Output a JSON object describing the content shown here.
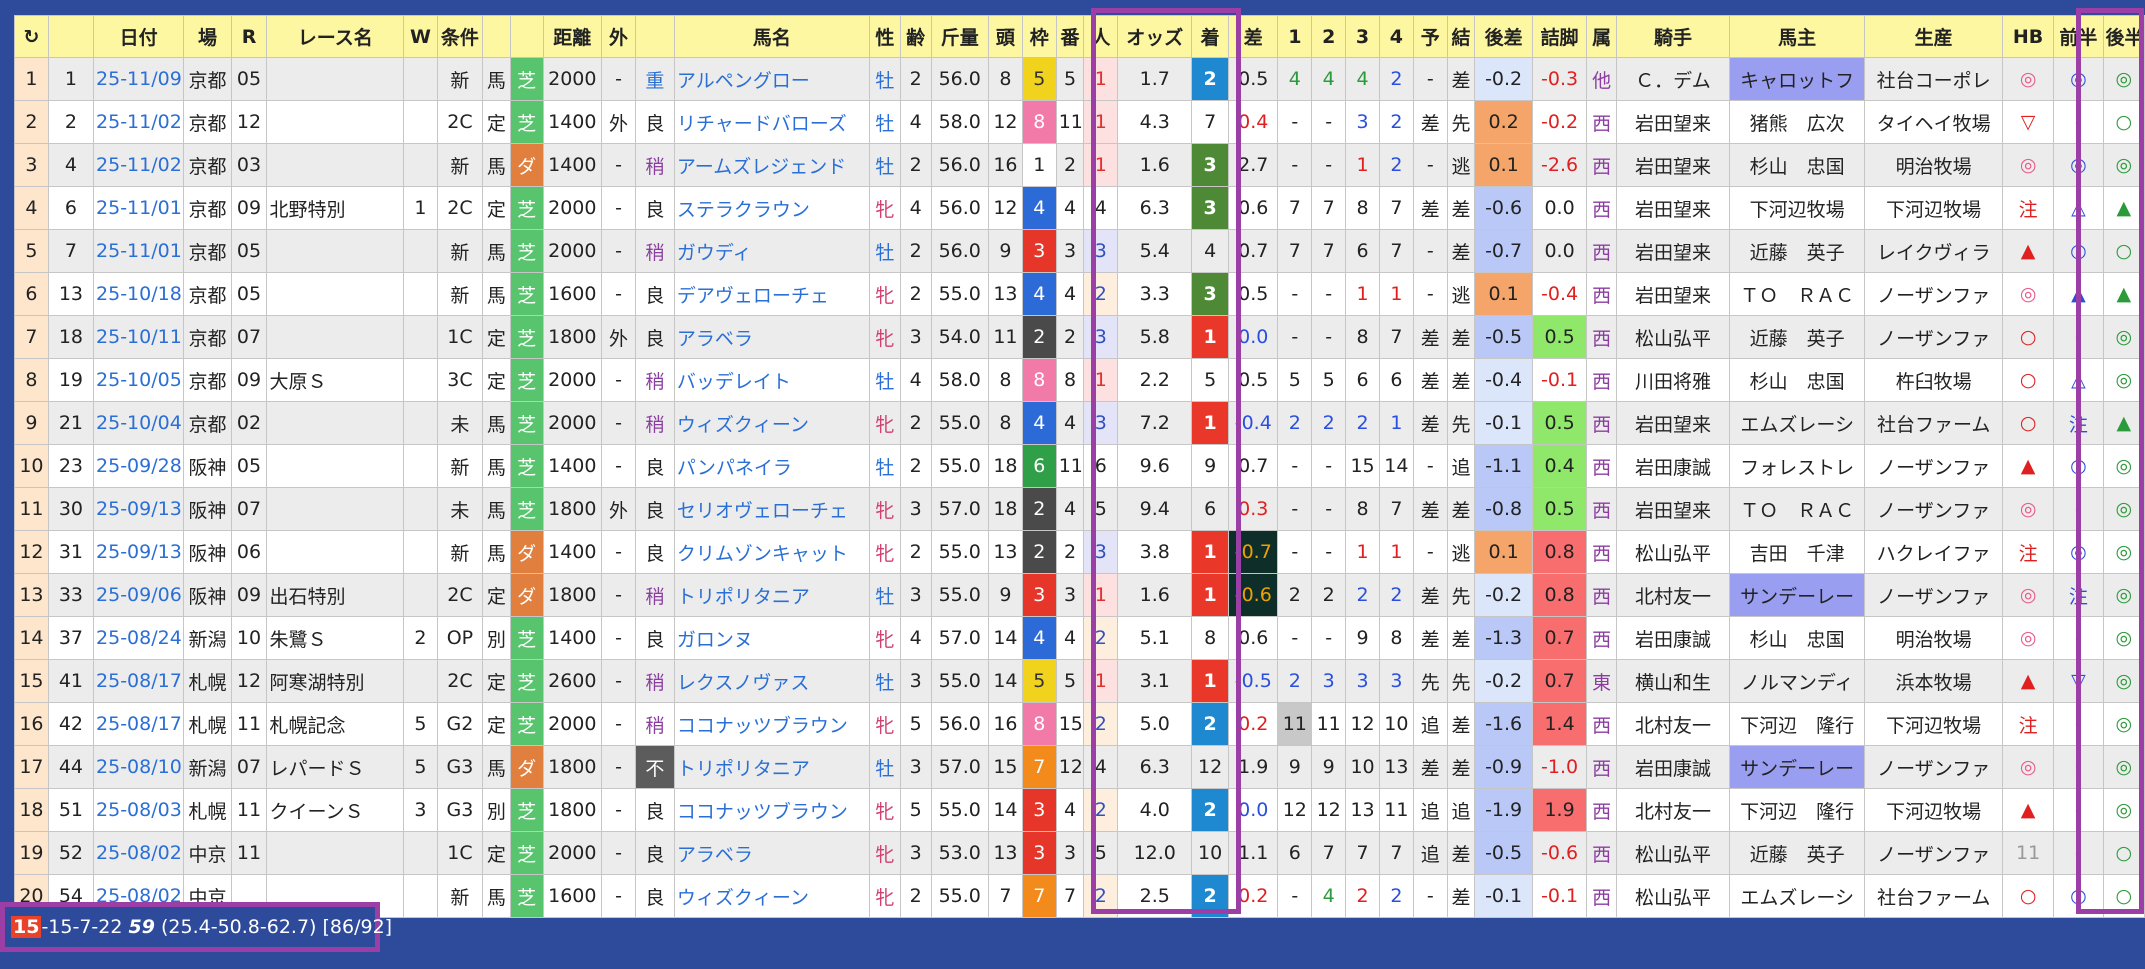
{
  "headers": [
    "↻",
    "",
    "日付",
    "場",
    "R",
    "レース名",
    "W",
    "条件",
    "",
    "",
    "距離",
    "外",
    "",
    "馬名",
    "性",
    "齢",
    "斤量",
    "頭",
    "枠",
    "番",
    "人",
    "オッズ",
    "着",
    "差",
    "1",
    "2",
    "3",
    "4",
    "予",
    "結",
    "後差",
    "詰脚",
    "属",
    "騎手",
    "馬主",
    "生産",
    "HB",
    "前半",
    "後半"
  ],
  "rows": [
    [
      "1",
      "1",
      "25-11/09",
      "京都",
      "05",
      "",
      "",
      "新",
      "馬",
      "芝",
      "2000",
      "-",
      "重",
      "アルペングロー",
      "牡",
      "2",
      "56.0",
      "8",
      "5",
      "5",
      "1",
      "1.7",
      "2",
      "0.5",
      "4",
      "4",
      "4",
      "2",
      "-",
      "差",
      "-0.2",
      "-0.3",
      "他",
      "Ｃ．デム",
      "キャロットフ",
      "社台コーポレ",
      "◎",
      "◎",
      "◎"
    ],
    [
      "2",
      "2",
      "25-11/02",
      "京都",
      "12",
      "",
      "",
      "2C",
      "定",
      "芝",
      "1400",
      "外",
      "良",
      "リチャードバローズ",
      "牡",
      "4",
      "58.0",
      "12",
      "8",
      "11",
      "1",
      "4.3",
      "7",
      "0.4",
      "-",
      "-",
      "3",
      "2",
      "差",
      "先",
      "0.2",
      "-0.2",
      "西",
      "岩田望来",
      "猪熊　広次",
      "タイヘイ牧場",
      "▽",
      "-",
      "○"
    ],
    [
      "3",
      "4",
      "25-11/02",
      "京都",
      "03",
      "",
      "",
      "新",
      "馬",
      "ダ",
      "1400",
      "-",
      "稍",
      "アームズレジェンド",
      "牡",
      "2",
      "56.0",
      "16",
      "1",
      "2",
      "1",
      "1.6",
      "3",
      "2.7",
      "-",
      "-",
      "1",
      "2",
      "-",
      "逃",
      "0.1",
      "-2.6",
      "西",
      "岩田望来",
      "杉山　忠国",
      "明治牧場",
      "◎",
      "◎",
      "◎"
    ],
    [
      "4",
      "6",
      "25-11/01",
      "京都",
      "09",
      "北野特別",
      "1",
      "2C",
      "定",
      "芝",
      "2000",
      "-",
      "良",
      "ステラクラウン",
      "牝",
      "4",
      "56.0",
      "12",
      "4",
      "4",
      "4",
      "6.3",
      "3",
      "0.6",
      "7",
      "7",
      "8",
      "7",
      "差",
      "差",
      "-0.6",
      "0.0",
      "西",
      "岩田望来",
      "下河辺牧場",
      "下河辺牧場",
      "注",
      "△",
      "▲"
    ],
    [
      "5",
      "7",
      "25-11/01",
      "京都",
      "05",
      "",
      "",
      "新",
      "馬",
      "芝",
      "2000",
      "-",
      "稍",
      "ガウディ",
      "牡",
      "2",
      "56.0",
      "9",
      "3",
      "3",
      "3",
      "5.4",
      "4",
      "0.7",
      "7",
      "7",
      "6",
      "7",
      "-",
      "差",
      "-0.7",
      "0.0",
      "西",
      "岩田望来",
      "近藤　英子",
      "レイクヴィラ",
      "▲",
      "○",
      "○"
    ],
    [
      "6",
      "13",
      "25-10/18",
      "京都",
      "05",
      "",
      "",
      "新",
      "馬",
      "芝",
      "1600",
      "-",
      "良",
      "デアヴェローチェ",
      "牝",
      "2",
      "55.0",
      "13",
      "4",
      "4",
      "2",
      "3.3",
      "3",
      "0.5",
      "-",
      "-",
      "1",
      "1",
      "-",
      "逃",
      "0.1",
      "-0.4",
      "西",
      "岩田望来",
      "ＴＯ　ＲＡＣ",
      "ノーザンファ",
      "◎",
      "▲",
      "▲"
    ],
    [
      "7",
      "18",
      "25-10/11",
      "京都",
      "07",
      "",
      "",
      "1C",
      "定",
      "芝",
      "1800",
      "外",
      "良",
      "アラベラ",
      "牝",
      "3",
      "54.0",
      "11",
      "2",
      "2",
      "3",
      "5.8",
      "1",
      "0.0",
      "-",
      "-",
      "8",
      "7",
      "差",
      "差",
      "-0.5",
      "0.5",
      "西",
      "松山弘平",
      "近藤　英子",
      "ノーザンファ",
      "○",
      "-",
      "◎"
    ],
    [
      "8",
      "19",
      "25-10/05",
      "京都",
      "09",
      "大原Ｓ",
      "",
      "3C",
      "定",
      "芝",
      "2000",
      "-",
      "稍",
      "バッデレイト",
      "牡",
      "4",
      "58.0",
      "8",
      "8",
      "8",
      "1",
      "2.2",
      "5",
      "0.5",
      "5",
      "5",
      "6",
      "6",
      "差",
      "差",
      "-0.4",
      "-0.1",
      "西",
      "川田将雅",
      "杉山　忠国",
      "杵臼牧場",
      "○",
      "△",
      "◎"
    ],
    [
      "9",
      "21",
      "25-10/04",
      "京都",
      "02",
      "",
      "",
      "未",
      "馬",
      "芝",
      "2000",
      "-",
      "稍",
      "ウィズクィーン",
      "牝",
      "2",
      "55.0",
      "8",
      "4",
      "4",
      "3",
      "7.2",
      "1",
      "-0.4",
      "2",
      "2",
      "2",
      "1",
      "差",
      "先",
      "-0.1",
      "0.5",
      "西",
      "岩田望来",
      "エムズレーシ",
      "社台ファーム",
      "○",
      "注",
      "▲"
    ],
    [
      "10",
      "23",
      "25-09/28",
      "阪神",
      "05",
      "",
      "",
      "新",
      "馬",
      "芝",
      "1400",
      "-",
      "良",
      "パンパネイラ",
      "牡",
      "2",
      "55.0",
      "18",
      "6",
      "11",
      "6",
      "9.6",
      "9",
      "0.7",
      "-",
      "-",
      "15",
      "14",
      "-",
      "追",
      "-1.1",
      "0.4",
      "西",
      "岩田康誠",
      "フォレストレ",
      "ノーザンファ",
      "▲",
      "○",
      "◎"
    ],
    [
      "11",
      "30",
      "25-09/13",
      "阪神",
      "07",
      "",
      "",
      "未",
      "馬",
      "芝",
      "1800",
      "外",
      "良",
      "セリオヴェローチェ",
      "牝",
      "3",
      "57.0",
      "18",
      "2",
      "4",
      "5",
      "9.4",
      "6",
      "0.3",
      "-",
      "-",
      "8",
      "7",
      "差",
      "差",
      "-0.8",
      "0.5",
      "西",
      "岩田望来",
      "ＴＯ　ＲＡＣ",
      "ノーザンファ",
      "◎",
      "-",
      "◎"
    ],
    [
      "12",
      "31",
      "25-09/13",
      "阪神",
      "06",
      "",
      "",
      "新",
      "馬",
      "ダ",
      "1400",
      "-",
      "良",
      "クリムゾンキャット",
      "牝",
      "2",
      "55.0",
      "13",
      "2",
      "2",
      "3",
      "3.8",
      "1",
      "-0.7",
      "-",
      "-",
      "1",
      "1",
      "-",
      "逃",
      "0.1",
      "0.8",
      "西",
      "松山弘平",
      "吉田　千津",
      "ハクレイファ",
      "注",
      "◎",
      "◎"
    ],
    [
      "13",
      "33",
      "25-09/06",
      "阪神",
      "09",
      "出石特別",
      "",
      "2C",
      "定",
      "ダ",
      "1800",
      "-",
      "稍",
      "トリポリタニア",
      "牡",
      "3",
      "55.0",
      "9",
      "3",
      "3",
      "1",
      "1.6",
      "1",
      "-0.6",
      "2",
      "2",
      "2",
      "2",
      "差",
      "先",
      "-0.2",
      "0.8",
      "西",
      "北村友一",
      "サンデーレー",
      "ノーザンファ",
      "◎",
      "注",
      "◎"
    ],
    [
      "14",
      "37",
      "25-08/24",
      "新潟",
      "10",
      "朱鷺Ｓ",
      "2",
      "OP",
      "別",
      "芝",
      "1400",
      "-",
      "良",
      "ガロンヌ",
      "牝",
      "4",
      "57.0",
      "14",
      "4",
      "4",
      "2",
      "5.1",
      "8",
      "0.6",
      "-",
      "-",
      "9",
      "8",
      "差",
      "差",
      "-1.3",
      "0.7",
      "西",
      "岩田康誠",
      "杉山　忠国",
      "明治牧場",
      "◎",
      "-",
      "◎"
    ],
    [
      "15",
      "41",
      "25-08/17",
      "札幌",
      "12",
      "阿寒湖特別",
      "",
      "2C",
      "定",
      "芝",
      "2600",
      "-",
      "稍",
      "レクスノヴァス",
      "牡",
      "3",
      "55.0",
      "14",
      "5",
      "5",
      "1",
      "3.1",
      "1",
      "-0.5",
      "2",
      "3",
      "3",
      "3",
      "先",
      "先",
      "-0.2",
      "0.7",
      "東",
      "横山和生",
      "ノルマンディ",
      "浜本牧場",
      "▲",
      "▽",
      "◎"
    ],
    [
      "16",
      "42",
      "25-08/17",
      "札幌",
      "11",
      "札幌記念",
      "5",
      "G2",
      "定",
      "芝",
      "2000",
      "-",
      "稍",
      "ココナッツブラウン",
      "牝",
      "5",
      "56.0",
      "16",
      "8",
      "15",
      "2",
      "5.0",
      "2",
      "0.2",
      "11",
      "11",
      "12",
      "10",
      "追",
      "差",
      "-1.6",
      "1.4",
      "西",
      "北村友一",
      "下河辺　隆行",
      "下河辺牧場",
      "注",
      "-",
      "◎"
    ],
    [
      "17",
      "44",
      "25-08/10",
      "新潟",
      "07",
      "レパードＳ",
      "5",
      "G3",
      "馬",
      "ダ",
      "1800",
      "-",
      "不",
      "トリポリタニア",
      "牡",
      "3",
      "57.0",
      "15",
      "7",
      "12",
      "4",
      "6.3",
      "12",
      "1.9",
      "9",
      "9",
      "10",
      "13",
      "差",
      "差",
      "-0.9",
      "-1.0",
      "西",
      "岩田康誠",
      "サンデーレー",
      "ノーザンファ",
      "◎",
      "-",
      "◎"
    ],
    [
      "18",
      "51",
      "25-08/03",
      "札幌",
      "11",
      "クイーンＳ",
      "3",
      "G3",
      "別",
      "芝",
      "1800",
      "-",
      "良",
      "ココナッツブラウン",
      "牝",
      "5",
      "55.0",
      "14",
      "3",
      "4",
      "2",
      "4.0",
      "2",
      "0.0",
      "12",
      "12",
      "13",
      "11",
      "追",
      "追",
      "-1.9",
      "1.9",
      "西",
      "北村友一",
      "下河辺　隆行",
      "下河辺牧場",
      "▲",
      "-",
      "◎"
    ],
    [
      "19",
      "52",
      "25-08/02",
      "中京",
      "11",
      "",
      "",
      "1C",
      "定",
      "芝",
      "2000",
      "-",
      "良",
      "アラベラ",
      "牝",
      "3",
      "53.0",
      "13",
      "3",
      "3",
      "5",
      "12.0",
      "10",
      "1.1",
      "6",
      "7",
      "7",
      "7",
      "追",
      "差",
      "-0.5",
      "-0.6",
      "西",
      "松山弘平",
      "近藤　英子",
      "ノーザンファ",
      "11",
      "-",
      "○"
    ],
    [
      "20",
      "54",
      "25-08/02",
      "中京",
      "",
      "",
      "",
      "新",
      "馬",
      "芝",
      "1600",
      "-",
      "良",
      "ウィズクィーン",
      "牝",
      "2",
      "55.0",
      "7",
      "7",
      "7",
      "2",
      "2.5",
      "2",
      "0.2",
      "-",
      "4",
      "2",
      "2",
      "-",
      "差",
      "-0.1",
      "-0.1",
      "西",
      "松山弘平",
      "エムズレーシ",
      "社台ファーム",
      "○",
      "○",
      "○"
    ]
  ],
  "status": {
    "first": "15",
    "rest": "-15-7-22 ",
    "bold": "59",
    "tail": " (25.4-50.8-62.7) [86/92]"
  },
  "colors": {
    "accent_frame": "#9b3fa6",
    "header_bg": "#fdf7a2",
    "background": "#2e4a9a"
  },
  "icons": {
    "refresh": "refresh-icon"
  }
}
